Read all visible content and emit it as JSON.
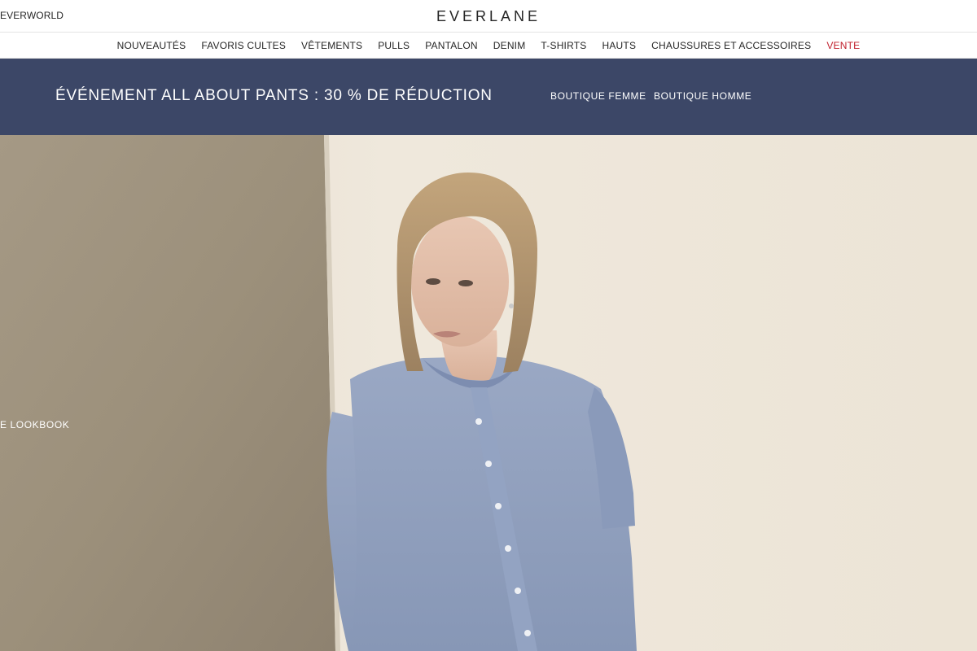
{
  "topbar": {
    "left_link": "EVERWORLD",
    "logo": "EVERLANE"
  },
  "nav": {
    "items": [
      {
        "label": "NOUVEAUTÉS"
      },
      {
        "label": "FAVORIS CULTES"
      },
      {
        "label": "VÊTEMENTS"
      },
      {
        "label": "PULLS"
      },
      {
        "label": "PANTALON"
      },
      {
        "label": "DENIM"
      },
      {
        "label": "T-SHIRTS"
      },
      {
        "label": "HAUTS"
      },
      {
        "label": "CHAUSSURES ET ACCESSOIRES"
      },
      {
        "label": "VENTE"
      }
    ],
    "sale_color": "#c0202d"
  },
  "promo": {
    "title": "ÉVÉNEMENT ALL ABOUT PANTS : 30 % DE RÉDUCTION",
    "women_link": "BOUTIQUE FEMME",
    "men_link": "BOUTIQUE HOMME",
    "background": "#3c4767"
  },
  "hero": {
    "lookbook_link": "E LOOKBOOK",
    "image": "woman-in-blue-knit-cardigan-leaning-on-wall"
  }
}
